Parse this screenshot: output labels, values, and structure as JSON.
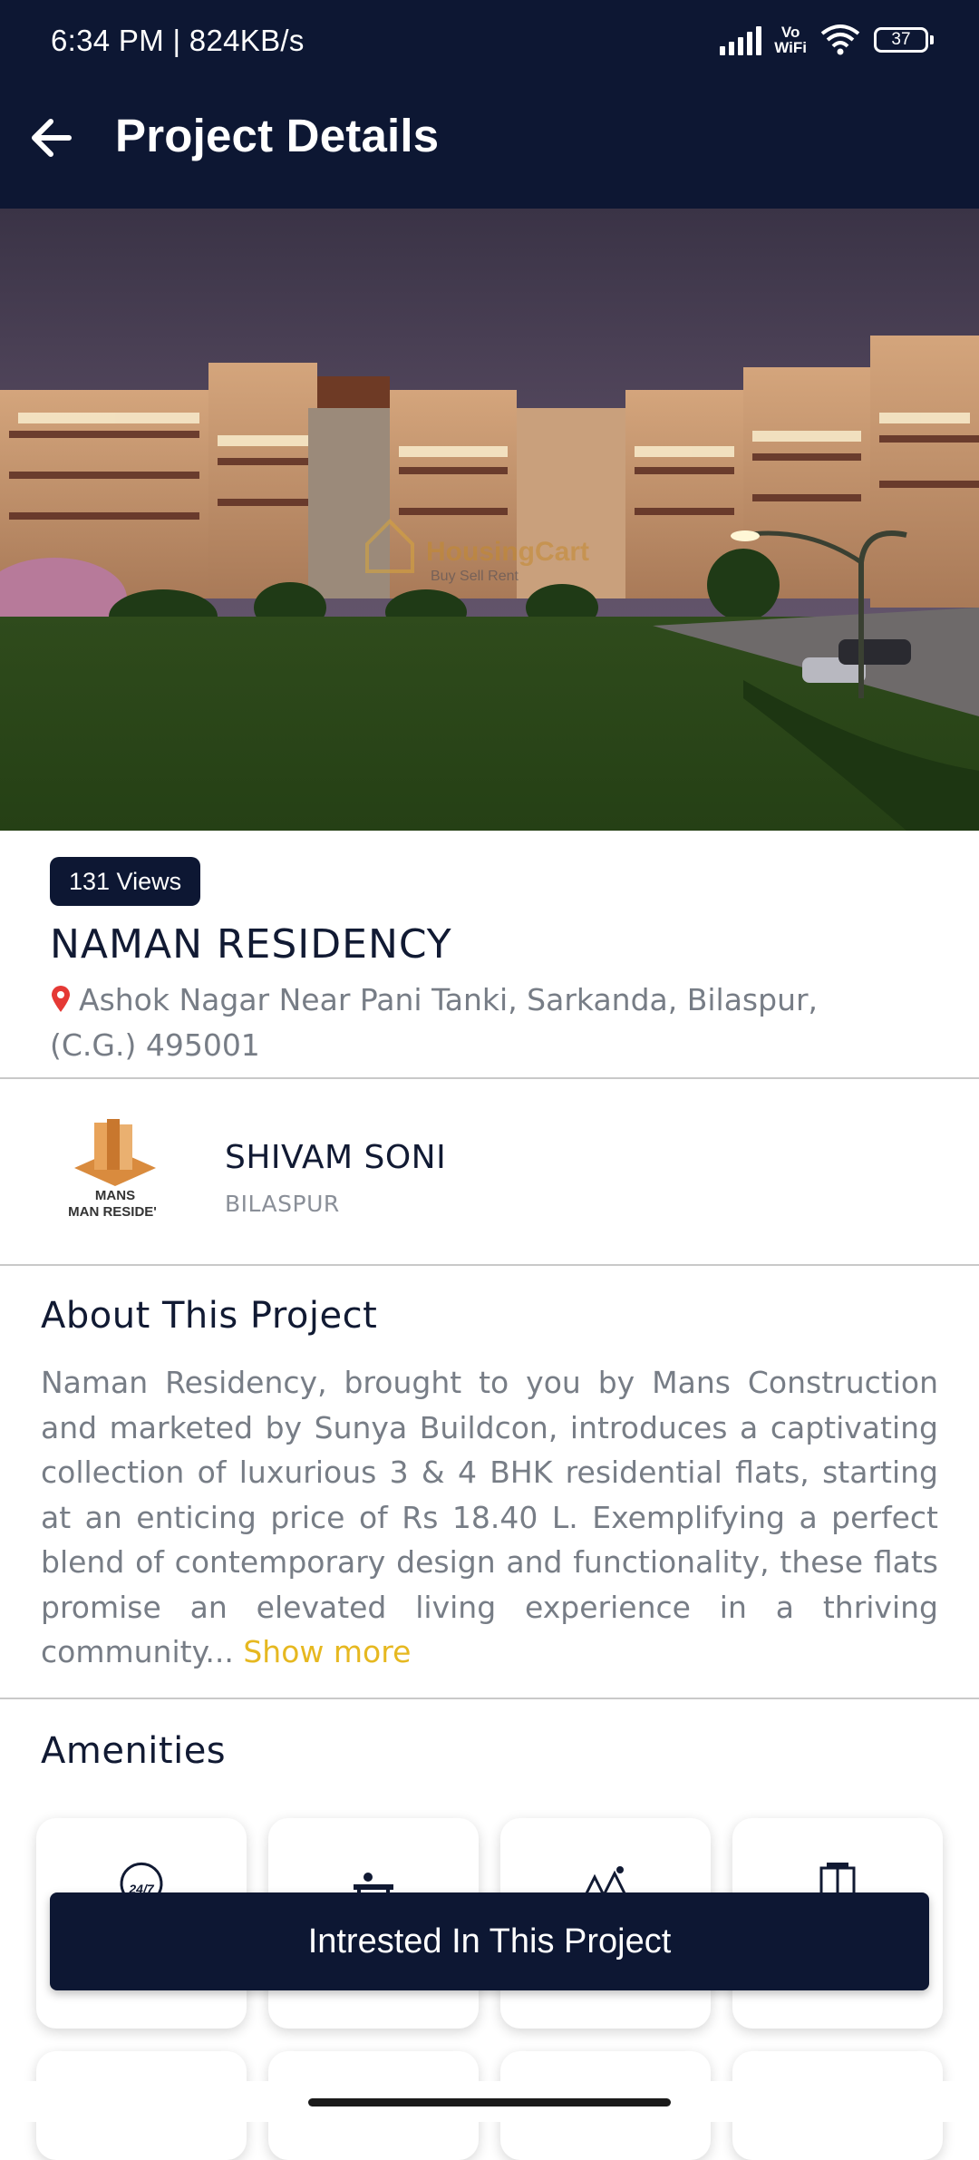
{
  "status_bar": {
    "time_speed": "6:34 PM | 824KB/s",
    "network_label": "Vo\nWiFi",
    "battery": "37"
  },
  "app_bar": {
    "title": "Project Details",
    "back_icon": "arrow-left-icon"
  },
  "hero": {
    "watermark_brand": "HousingCart",
    "watermark_tagline": "Buy Sell Rent"
  },
  "project": {
    "views": "131 Views",
    "name": "NAMAN RESIDENCY",
    "address": "Ashok Nagar Near Pani Tanki, Sarkanda, Bilaspur, (C.G.) 495001",
    "address_icon": "location-pin-icon"
  },
  "builder": {
    "logo_text_1": "MANS",
    "logo_text_2": "MAN RESIDE'",
    "name": "SHIVAM SONI",
    "city": "BILASPUR"
  },
  "about": {
    "title": "About This Project",
    "text": "Naman Residency, brought to you by Mans Construction and marketed by Sunya Buildcon, introduces a captivating collection of luxurious 3 & 4 BHK residential flats, starting at an enticing price of Rs 18.40 L. Exemplifying a perfect blend of contemporary design and functionality, these flats promise an elevated living experience in a thriving community...",
    "show_more": "Show more"
  },
  "amenities": {
    "title": "Amenities",
    "items": [
      {
        "icon": "24-7-clock-icon",
        "label": "24/7"
      },
      {
        "icon": "desk-icon"
      },
      {
        "icon": "park-icon"
      },
      {
        "icon": "lift-icon"
      }
    ]
  },
  "cta": {
    "label": "Intrested In This Project"
  },
  "colors": {
    "primary": "#0d1733",
    "accent": "#e6b820",
    "muted_text": "#777d86"
  }
}
